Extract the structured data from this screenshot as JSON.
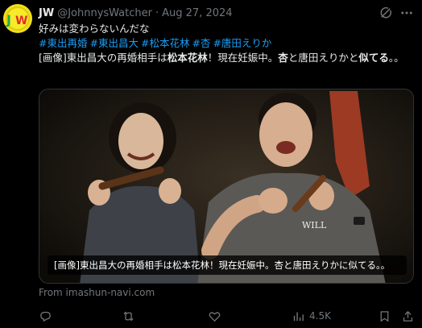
{
  "tweet": {
    "display_name": "JW",
    "handle": "@JohnnysWatcher",
    "separator": "·",
    "date": "Aug 27, 2024",
    "text_line1": "好みは変わらないんだな",
    "hashtags": [
      "#東出再婚",
      "#東出昌大",
      "#松本花林",
      "#杏",
      "#唐田えりか"
    ],
    "body_parts": [
      {
        "text": "[画像]東出昌大の再婚相手は",
        "bold": false
      },
      {
        "text": "松本花林",
        "bold": true
      },
      {
        "text": "！現在妊娠中。",
        "bold": false
      },
      {
        "text": "杏",
        "bold": true
      },
      {
        "text": "と唐田えりかと",
        "bold": false
      },
      {
        "text": "似てる",
        "bold": true
      },
      {
        "text": "。。",
        "bold": false
      }
    ],
    "media_caption": "[画像]東出昌大の再婚相手は松本花林！現在妊娠中。杏と唐田えりかに似てる。。",
    "shirt_text": "WILL",
    "source": "From imashun-navi.com",
    "views": "4.5K"
  },
  "avatar": {
    "letters_left": "J",
    "letters_right": "W"
  },
  "icons": {
    "grok": "grok-icon",
    "more": "more-icon",
    "reply": "reply-icon",
    "retweet": "retweet-icon",
    "like": "like-icon",
    "views": "views-icon",
    "bookmark": "bookmark-icon",
    "share": "share-icon"
  },
  "colors": {
    "link": "#1d9bf0",
    "muted": "#71767b",
    "text": "#e7e9ea",
    "background": "#000000"
  }
}
